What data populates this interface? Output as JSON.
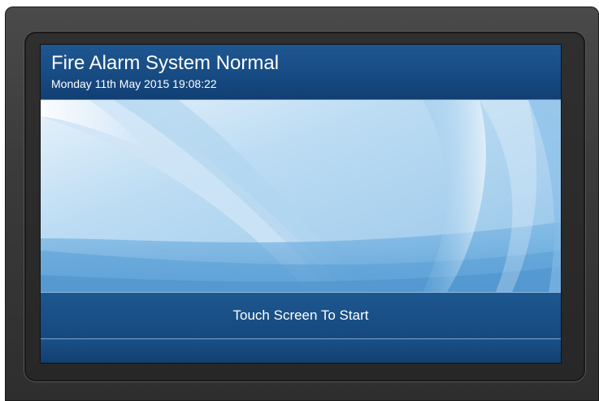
{
  "header": {
    "title": "Fire Alarm System Normal",
    "datetime": "Monday 11th May 2015 19:08:22"
  },
  "footer": {
    "start_label": "Touch Screen To Start"
  },
  "colors": {
    "panel_blue": "#174b83",
    "bezel": "#3b3b3b",
    "wallpaper_light": "#dcecf8",
    "wallpaper_mid": "#9ec9ea"
  },
  "wallpaper": {
    "name": "abstract-blue-swoosh"
  }
}
